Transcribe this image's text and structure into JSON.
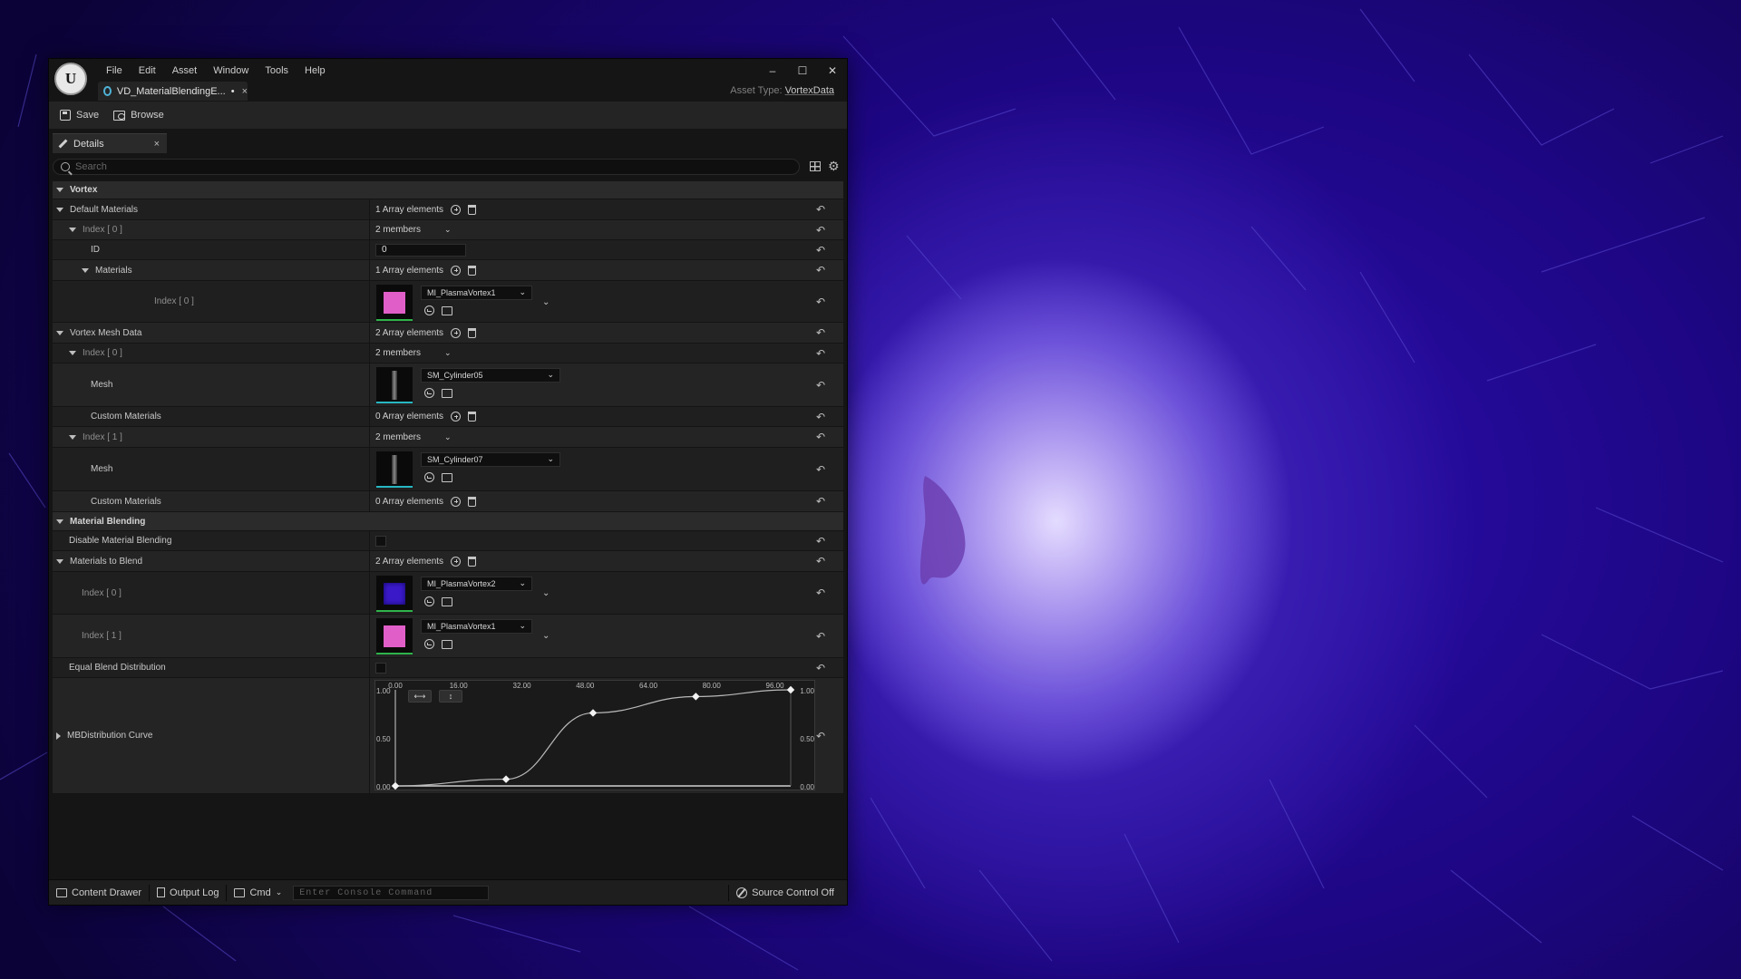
{
  "menu": [
    "File",
    "Edit",
    "Asset",
    "Window",
    "Tools",
    "Help"
  ],
  "asset_tab": {
    "label": "VD_MaterialBlendingE...",
    "modified": "•",
    "close": "×"
  },
  "window_controls": {
    "minimize": "–",
    "maximize": "☐",
    "close": "✕"
  },
  "asset_type": {
    "label": "Asset Type:",
    "value": "VortexData"
  },
  "toolbar": {
    "save_label": "Save",
    "browse_label": "Browse"
  },
  "details_tab": {
    "label": "Details",
    "close": "×"
  },
  "search": {
    "placeholder": "Search"
  },
  "rows": {
    "vortex": "Vortex",
    "default_materials": {
      "label": "Default Materials",
      "value": "1 Array elements"
    },
    "dm_index0": {
      "label": "Index [ 0 ]",
      "value": "2 members"
    },
    "dm_id": {
      "label": "ID",
      "value": "0"
    },
    "dm_materials": {
      "label": "Materials",
      "value": "1 Array elements"
    },
    "dm_mat_index0": {
      "label": "Index [ 0 ]",
      "asset": "MI_PlasmaVortex1"
    },
    "vortex_mesh_data": {
      "label": "Vortex Mesh Data",
      "value": "2 Array elements"
    },
    "vm_index0": {
      "label": "Index [ 0 ]",
      "value": "2 members"
    },
    "vm_mesh0": {
      "label": "Mesh",
      "asset": "SM_Cylinder05"
    },
    "vm_custom0": {
      "label": "Custom Materials",
      "value": "0 Array elements"
    },
    "vm_index1": {
      "label": "Index [ 1 ]",
      "value": "2 members"
    },
    "vm_mesh1": {
      "label": "Mesh",
      "asset": "SM_Cylinder07"
    },
    "vm_custom1": {
      "label": "Custom Materials",
      "value": "0 Array elements"
    },
    "material_blending": "Material Blending",
    "disable_blending": {
      "label": "Disable Material Blending"
    },
    "materials_to_blend": {
      "label": "Materials to Blend",
      "value": "2 Array elements"
    },
    "mtb_index0": {
      "label": "Index [ 0 ]",
      "asset": "MI_PlasmaVortex2"
    },
    "mtb_index1": {
      "label": "Index [ 1 ]",
      "asset": "MI_PlasmaVortex1"
    },
    "equal_blend": {
      "label": "Equal Blend Distribution"
    },
    "mb_curve": {
      "label": "MBDistribution Curve"
    }
  },
  "colors": {
    "plasma1": "#e05ec8",
    "plasma2": "#3a1ac8",
    "material_bar": "#2fb34a",
    "mesh_bar": "#27b7c2"
  },
  "chart_data": {
    "type": "line",
    "x_ticks": [
      "0.00",
      "16.00",
      "32.00",
      "48.00",
      "64.00",
      "80.00",
      "96.00"
    ],
    "y_ticks": [
      "1.00",
      "0.50",
      "0.00"
    ],
    "xlim": [
      0,
      100
    ],
    "ylim": [
      0,
      1
    ],
    "keys": [
      {
        "x": 0,
        "y": 0
      },
      {
        "x": 28,
        "y": 0.07
      },
      {
        "x": 50,
        "y": 0.76
      },
      {
        "x": 76,
        "y": 0.93
      },
      {
        "x": 100,
        "y": 1.0
      }
    ]
  },
  "statusbar": {
    "content_drawer": "Content Drawer",
    "output_log": "Output Log",
    "cmd": "Cmd",
    "console_placeholder": "Enter Console Command",
    "source_control": "Source Control Off"
  }
}
